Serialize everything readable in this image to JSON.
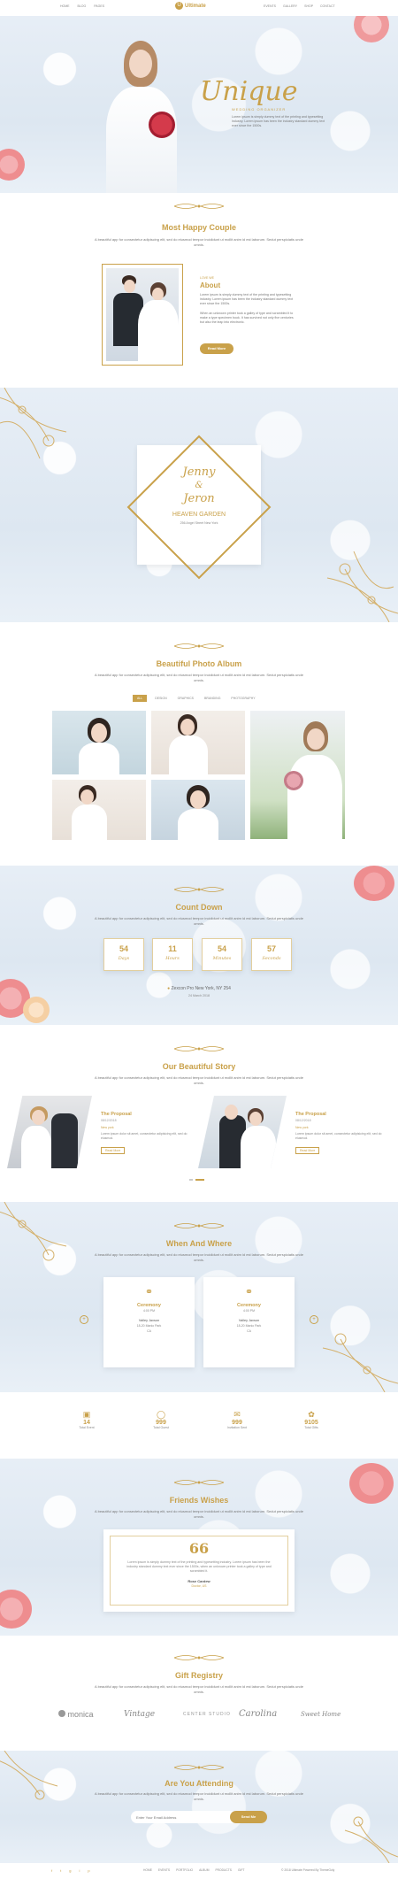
{
  "nav": {
    "left": [
      "HOME",
      "BLOG",
      "PAGES"
    ],
    "logo": "Ultimate",
    "right": [
      "EVENTS",
      "GALLERY",
      "SHOP",
      "CONTACT"
    ]
  },
  "hero": {
    "script_title": "Unique",
    "tagline": "WEDDING ORGANIZER",
    "text": "Lorem ipsum is simply dummy text of the printing and typesetting industry. Lorem ipsum has been the industry standard dummy text ever since the 1500s."
  },
  "couple": {
    "title": "Most Happy Couple",
    "subtitle": "A beautiful app for consectetur adipiscing elit, sed do eiusmod tempor incididunt ut mollit anim id est laborum. Sedut perspiciatis unde omnis.",
    "kicker": "LOVE WE",
    "about_title": "About",
    "about_text_1": "Lorem ipsum is simply dummy text of the printing and typesetting industry. Lorem ipsum has been the industry standard dummy text ever since the 1500s.",
    "about_text_2": "When an unknown printer took a galley of type and scrambled it to make a type specimen book. It has survived not only five centuries but also the leap into electronic.",
    "button": "Read More"
  },
  "invite": {
    "name1": "Jenny",
    "amp": "&",
    "name2": "Jeron",
    "venue": "HEAVEN GARDEN",
    "address": "256 Angel Street New York"
  },
  "album": {
    "title": "Beautiful Photo Album",
    "subtitle": "A beautiful app for consectetur adipiscing elit, sed do eiusmod tempor incididunt ut mollit anim id est laborum. Sedut perspiciatis unde omnis.",
    "filters": [
      "ALL",
      "DESIGN",
      "GRAPHICS",
      "BRANDING",
      "PHOTOGRAPHY"
    ]
  },
  "countdown": {
    "title": "Count Down",
    "subtitle": "A beautiful app for consectetur adipiscing elit, sed do eiusmod tempor incididunt ut mollit anim id est laborum. Sedut perspiciatis unde omnis.",
    "boxes": [
      {
        "value": "54",
        "label": "Days"
      },
      {
        "value": "11",
        "label": "Hours"
      },
      {
        "value": "54",
        "label": "Minutes"
      },
      {
        "value": "57",
        "label": "Seconds"
      }
    ],
    "location": "Zexcon Pro New York, NY 254",
    "date": "24 March 2018"
  },
  "story": {
    "title": "Our Beautiful Story",
    "subtitle": "A beautiful app for consectetur adipiscing elit, sed do eiusmod tempor incididunt ut mollit anim id est laborum. Sedut perspiciatis unde omnis.",
    "items": [
      {
        "title": "The Proposal",
        "date": "08/12/2018",
        "place": "New york",
        "text": "Lorem ipsum dolor sit amet, consectetur adipisicing elit, sed do eiusmod.",
        "button": "Read More"
      },
      {
        "title": "The Proposal",
        "date": "08/12/2018",
        "place": "New york",
        "text": "Lorem ipsum dolor sit amet, consectetur adipisicing elit, sed do eiusmod.",
        "button": "Read More"
      }
    ]
  },
  "when": {
    "title": "When And Where",
    "subtitle": "A beautiful app for consectetur adipiscing elit, sed do eiusmod tempor incididunt ut mollit anim id est laborum. Sedut perspiciatis unde omnis.",
    "cards": [
      {
        "title": "Ceremony",
        "time": "4:00 PM",
        "name": "Valley Jaxson",
        "addr": "18-20 Manio Park",
        "city": "CA"
      },
      {
        "title": "Ceremony",
        "time": "4:00 PM",
        "name": "Valley Jaxson",
        "addr": "18-20 Manio Park",
        "city": "CA"
      }
    ]
  },
  "stats": [
    {
      "value": "14",
      "label": "Total Event"
    },
    {
      "value": "999",
      "label": "Total Guest"
    },
    {
      "value": "999",
      "label": "Invitation Sent"
    },
    {
      "value": "9105",
      "label": "Total Gifts"
    }
  ],
  "wishes": {
    "title": "Friends Wishes",
    "subtitle": "A beautiful app for consectetur adipiscing elit, sed do eiusmod tempor incididunt ut mollit anim id est laborum. Sedut perspiciatis unde omnis.",
    "quote_mark": "66",
    "text": "Lorem ipsum is simply dummy text of the printing and typesetting industry. Lorem ipsum has been the industry standard dummy text ever since the 1500s, when an unknown printer took a galley of type and scrambled it.",
    "author": "Rose Cardew",
    "role": "Doctor, US"
  },
  "registry": {
    "title": "Gift Registry",
    "subtitle": "A beautiful app for consectetur adipiscing elit, sed do eiusmod tempor incididunt ut mollit anim id est laborum. Sedut perspiciatis unde omnis.",
    "brands": [
      "monica",
      "Vintage",
      "CENTER STUDIO",
      "Carolina",
      "Sweet Home"
    ]
  },
  "rsvp": {
    "title": "Are You Attending",
    "subtitle": "A beautiful app for consectetur adipiscing elit, sed do eiusmod tempor incididunt ut mollit anim id est laborum. Sedut perspiciatis unde omnis.",
    "placeholder": "Enter Your Email Address",
    "button": "Send Me"
  },
  "footer": {
    "social": [
      "f",
      "t",
      "g",
      "i",
      "p"
    ],
    "links": [
      "HOME",
      "EVENTS",
      "PORTFOLIO",
      "ALBUM",
      "PRODUCTS",
      "GIFT"
    ],
    "copyright": "© 2018 Ultimate Powered By ThemeGoly"
  },
  "colors": {
    "gold": "#c9a14a",
    "sky": "#e3ebf4",
    "rose": "#ee8d8f"
  }
}
